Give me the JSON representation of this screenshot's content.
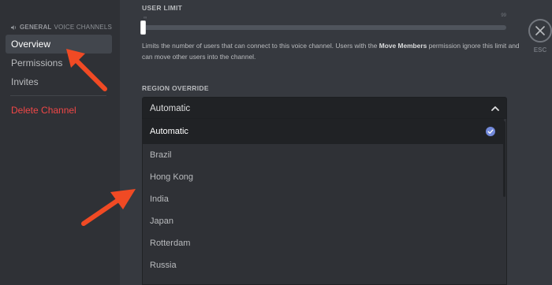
{
  "sidebar": {
    "channel_name": "GENERAL",
    "channel_type": "VOICE CHANNELS",
    "items": [
      {
        "label": "Overview",
        "active": true
      },
      {
        "label": "Permissions"
      },
      {
        "label": "Invites"
      }
    ],
    "delete_label": "Delete Channel"
  },
  "user_limit": {
    "label": "USER LIMIT",
    "min_tick": "∞",
    "max_tick": "99",
    "value_fraction": 0,
    "help_before": "Limits the number of users that can connect to this voice channel. Users with the ",
    "help_bold": "Move Members",
    "help_after": " permission ignore this limit and can move other users into the channel."
  },
  "close": {
    "label": "ESC",
    "icon": "close-icon"
  },
  "region": {
    "label": "REGION OVERRIDE",
    "selected": "Automatic",
    "options": [
      "Automatic",
      "Brazil",
      "Hong Kong",
      "India",
      "Japan",
      "Rotterdam",
      "Russia"
    ]
  },
  "colors": {
    "accent": "#7289da",
    "danger": "#f04747",
    "annotation": "#f04a24"
  }
}
